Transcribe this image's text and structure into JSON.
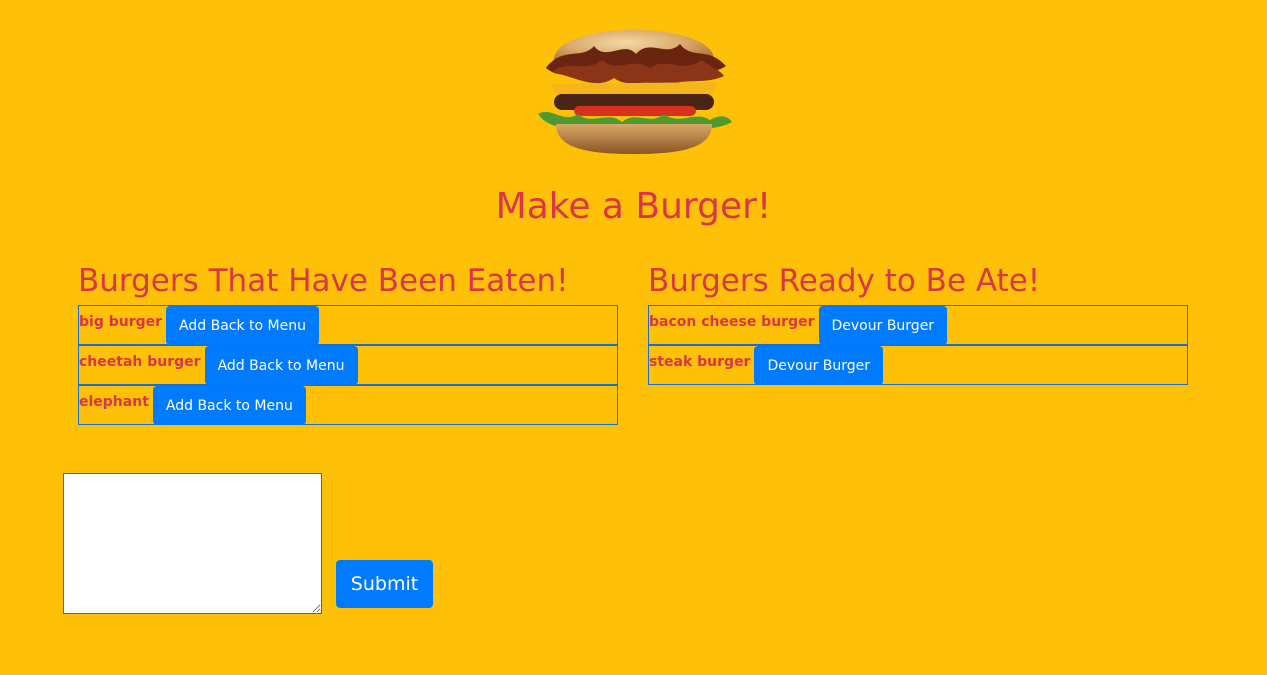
{
  "header": {
    "title": "Make a Burger!"
  },
  "eaten": {
    "heading": "Burgers That Have Been Eaten!",
    "items": [
      {
        "name": "big burger",
        "button_label": "Add Back to Menu"
      },
      {
        "name": "cheetah burger",
        "button_label": "Add Back to Menu"
      },
      {
        "name": "elephant",
        "button_label": "Add Back to Menu"
      }
    ]
  },
  "ready": {
    "heading": "Burgers Ready to Be Ate!",
    "items": [
      {
        "name": "bacon cheese burger",
        "button_label": "Devour Burger"
      },
      {
        "name": "steak burger",
        "button_label": "Devour Burger"
      }
    ]
  },
  "form": {
    "textarea_value": "",
    "submit_label": "Submit"
  },
  "colors": {
    "background": "#FFC107",
    "heading_red": "#DC3545",
    "button_blue": "#007BFF",
    "border_blue": "#1a6fd6"
  },
  "icons": {
    "hero": "burger-image"
  }
}
